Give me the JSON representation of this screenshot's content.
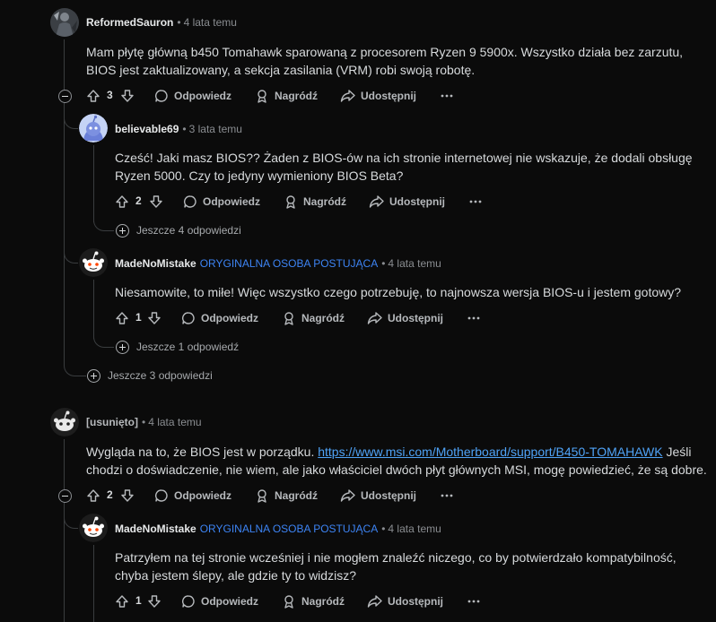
{
  "labels": {
    "reply": "Odpowiedz",
    "award": "Nagródź",
    "share": "Udostępnij",
    "op_badge": "ORYGINALNA OSOBA POSTUJĄCA",
    "dot": "•"
  },
  "comments": [
    {
      "username": "ReformedSauron",
      "time": "4 lata temu",
      "text": "Mam płytę główną b450 Tomahawk sparowaną z procesorem Ryzen 9 5900x. Wszystko działa bez zarzutu, BIOS jest zaktualizowany, a sekcja zasilania (VRM) robi swoją robotę.",
      "score": "3"
    },
    {
      "username": "believable69",
      "time": "3 lata temu",
      "text": "Cześć! Jaki masz BIOS?? Żaden z BIOS-ów na ich stronie internetowej nie wskazuje, że dodali obsługę Ryzen 5000. Czy to jedyny wymieniony BIOS Beta?",
      "score": "2",
      "more": "Jeszcze 4 odpowiedzi"
    },
    {
      "username": "MadeNoMistake",
      "time": "4 lata temu",
      "text": "Niesamowite, to miłe! Więc wszystko czego potrzebuję, to najnowsza wersja BIOS-u i jestem gotowy?",
      "score": "1",
      "more": "Jeszcze 1 odpowiedź"
    },
    {
      "username": "[usunięto]",
      "time": "4 lata temu",
      "text_before": "Wygląda na to, że BIOS jest w porządku.",
      "link": "https://www.msi.com/Motherboard/support/B450-TOMAHAWK",
      "text_after": "Jeśli chodzi o doświadczenie, nie wiem, ale jako właściciel dwóch płyt głównych MSI, mogę powiedzieć, że są dobre.",
      "score": "2"
    },
    {
      "username": "MadeNoMistake",
      "time": "4 lata temu",
      "text": "Patrzyłem na tej stronie wcześniej i nie mogłem znaleźć niczego, co by potwierdzało kompatybilność, chyba jestem ślepy, ale gdzie ty to widzisz?",
      "score": "1"
    }
  ],
  "thread_more": "Jeszcze 3 odpowiedzi"
}
